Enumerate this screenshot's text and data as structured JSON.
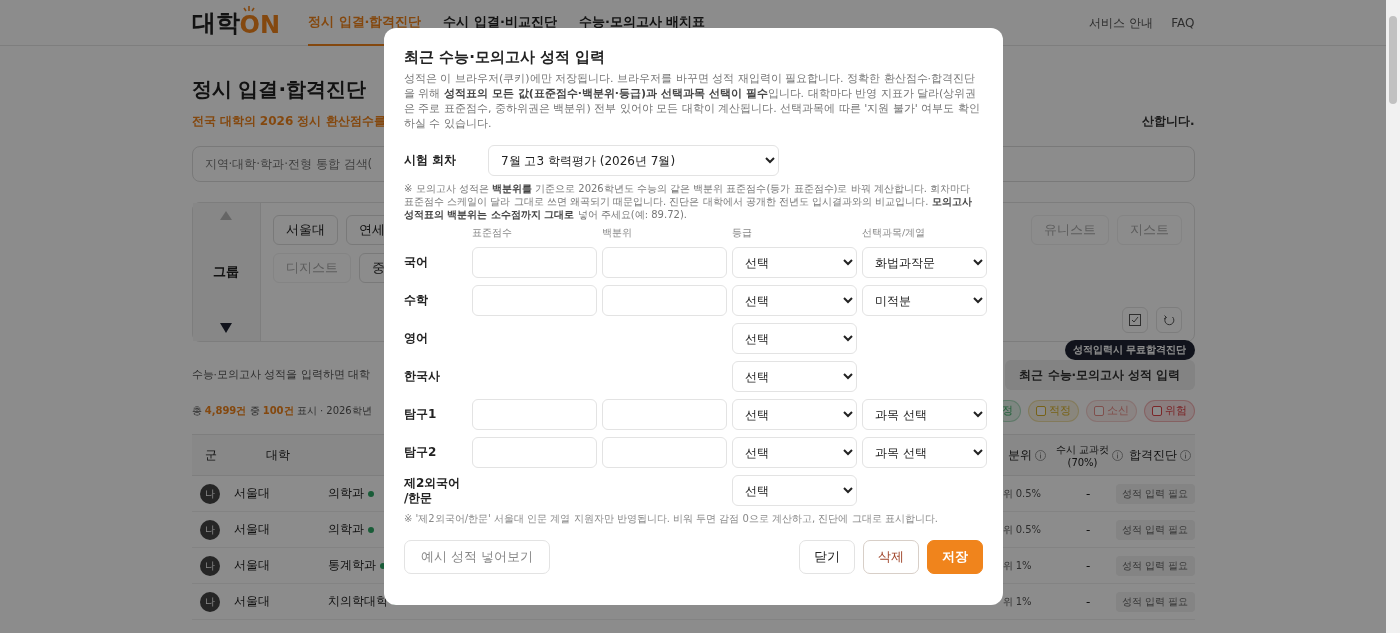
{
  "header": {
    "logo": {
      "main": "대학",
      "accent": "ON"
    },
    "nav": [
      {
        "label": "정시 입결·합격진단",
        "selected": true
      },
      {
        "label": "수시 입결·비교진단",
        "selected": false
      },
      {
        "label": "수능·모의고사 배치표",
        "selected": false
      }
    ],
    "links": [
      "서비스 안내",
      "FAQ"
    ]
  },
  "page": {
    "title": "정시 입결·합격진단",
    "subtitle_left": "전국 대학의 2026 정시 환산점수를",
    "subtitle_right": "산합니다.",
    "search_placeholder": "지역·대학·학과·전형 통합 검색(",
    "filter": {
      "group_label": "그룹",
      "row1_left": [
        {
          "label": "서울대",
          "disabled": false
        },
        {
          "label": "연세",
          "disabled": false
        }
      ],
      "row1_right": [
        {
          "label": "유니스트",
          "disabled": true
        },
        {
          "label": "지스트",
          "disabled": true
        }
      ],
      "row2_left": [
        {
          "label": "디지스트",
          "disabled": true
        },
        {
          "label": "중",
          "disabled": false
        }
      ]
    },
    "info_text": "수능·모의고사 성적을 입력하면 대학",
    "tooltip": "성적입력시 무료합격진단",
    "score_button": "최근 수능·모의고사 성적 입력",
    "count_text": "총 **4,899건** 중 **100건** 표시 · 2026학년",
    "result_filters": [
      {
        "label": "정",
        "kind": "safe"
      },
      {
        "label": "적정",
        "checked": false,
        "kind": "fit"
      },
      {
        "label": "소신",
        "checked": false,
        "kind": "reach"
      },
      {
        "label": "위험",
        "checked": false,
        "kind": "risk"
      }
    ],
    "table": {
      "columns_left": [
        "군",
        "대학"
      ],
      "columns_right": [
        {
          "lines": [
            "분위"
          ]
        },
        {
          "lines": [
            "수시 교과컷",
            "(70%)"
          ]
        },
        {
          "lines": [
            "합격진단"
          ]
        }
      ],
      "rows": [
        {
          "group": "나",
          "university": "서울대",
          "major": "의학과",
          "percentile": "위 0.5%",
          "cut": "-",
          "diagnosis": "성적 입력 필요"
        },
        {
          "group": "나",
          "university": "서울대",
          "major": "의학과",
          "percentile": "위 0.5%",
          "cut": "-",
          "diagnosis": "성적 입력 필요"
        },
        {
          "group": "나",
          "university": "서울대",
          "major": "통계학과",
          "percentile": "위 1%",
          "cut": "-",
          "diagnosis": "성적 입력 필요"
        },
        {
          "group": "나",
          "university": "서울대",
          "major": "치의학대학",
          "percentile": "위 1%",
          "cut": "-",
          "diagnosis": "성적 입력 필요"
        }
      ]
    }
  },
  "modal": {
    "title": "최근 수능·모의고사 성적 입력",
    "description": "성적은 이 브라우저(쿠키)에만 저장됩니다. 브라우저를 바꾸면 성적 재입력이 필요합니다. 정확한 환산점수·합격진단을 위해 **성적표의 모든 값(표준점수·백분위·등급)과 선택과목 선택이 필수**입니다. 대학마다 반영 지표가 달라(상위권은 주로 표준점수, 중하위권은 백분위) 전부 있어야 모든 대학이 계산됩니다. 선택과목에 따른 '지원 불가' 여부도 확인 하실 수 있습니다.",
    "exam_label": "시험 회차",
    "exam_value": "7월 고3 학력평가 (2026년 7월)",
    "exam_note": "※ 모의고사 성적은 **백분위를** 기준으로 2026학년도 수능의 같은 백분위 표준점수(등가 표준점수)로 바꿔 계산합니다. 회차마다 표준점수 스케일이 달라 그대로 쓰면 왜곡되기 때문입니다. 진단은 대학에서 공개한 전년도 입시결과와의 비교입니다. **모의고사 성적표의 백분위는 소수점까지 그대로** 넣어 주세요(예: 89.72).",
    "columns": [
      "표준점수",
      "백분위",
      "등급",
      "선택과목/계열"
    ],
    "rows": [
      {
        "kind": "full",
        "label": [
          "국어"
        ],
        "grade": "선택",
        "elective": "화법과작문"
      },
      {
        "kind": "full",
        "label": [
          "수학"
        ],
        "grade": "선택",
        "elective": "미적분"
      },
      {
        "kind": "grade",
        "label": [
          "영어"
        ],
        "grade": "선택"
      },
      {
        "kind": "grade",
        "label": [
          "한국사"
        ],
        "grade": "선택"
      },
      {
        "kind": "full",
        "label": [
          "탐구1"
        ],
        "grade": "선택",
        "elective": "과목 선택"
      },
      {
        "kind": "full",
        "label": [
          "탐구2"
        ],
        "grade": "선택",
        "elective": "과목 선택"
      },
      {
        "kind": "grade",
        "label": [
          "제2외국어",
          "/한문"
        ],
        "grade": "선택"
      }
    ],
    "footnote": "※ '제2외국어/한문' 서울대 인문 계열 지원자만 반영됩니다. 비워 두면 감점 0으로 계산하고, 진단에 그대로 표시합니다.",
    "sample_button": "예시 성적 넣어보기",
    "buttons": [
      {
        "kind": "plain",
        "label": "닫기"
      },
      {
        "kind": "danger",
        "label": "삭제"
      },
      {
        "kind": "primary",
        "label": "저장"
      }
    ]
  }
}
